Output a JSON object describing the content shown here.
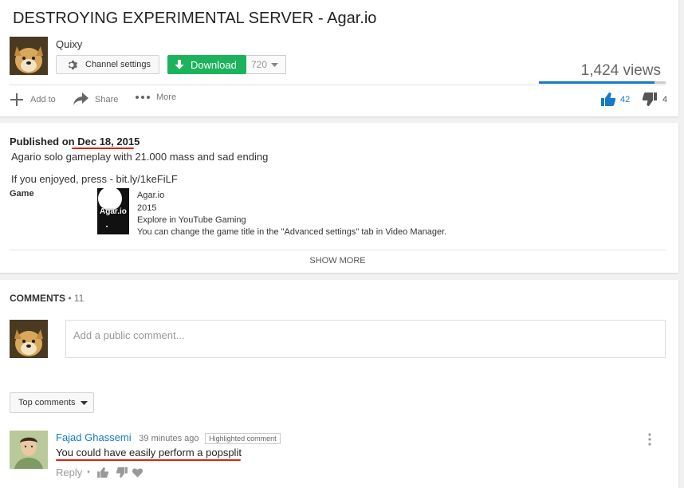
{
  "video": {
    "title": "DESTROYING EXPERIMENTAL SERVER - Agar.io",
    "channel_name": "Quixy",
    "channel_settings_label": "Channel settings",
    "download_label": "Download",
    "quality": "720",
    "views": "1,424 views",
    "actions": {
      "add_to": "Add to",
      "share": "Share",
      "more": "More"
    },
    "likes": "42",
    "dislikes": "4",
    "like_ratio": 0.91
  },
  "description": {
    "published_prefix": "Published on ",
    "published_date": "Dec 18, 2015",
    "line1": "Agario solo gameplay with 21.000 mass and sad ending",
    "line2": "If you enjoyed, press - bit.ly/1keFiLF",
    "game_label": "Game",
    "game_thumb_text": "Agar.io",
    "game_title": "Agar.io",
    "game_year": "2015",
    "game_explore": "Explore in YouTube Gaming",
    "game_note": "You can change the game title in the \"Advanced settings\" tab in Video Manager.",
    "show_more": "SHOW MORE"
  },
  "comments": {
    "header": "COMMENTS",
    "separator": " • ",
    "count": "11",
    "placeholder": "Add a public comment...",
    "sort_label": "Top comments",
    "items": [
      {
        "author": "Fajad Ghassemi",
        "time": "39 minutes ago",
        "badge": "Highlighted comment",
        "text": "You could have easily perform a popsplit",
        "reply": "Reply",
        "reply_sep": "•"
      }
    ]
  },
  "colors": {
    "accent_blue": "#167ac6",
    "download_green": "#1cb35c",
    "annotation_red": "#dd1111"
  },
  "icons": [
    "gear-icon",
    "download-arrow-icon",
    "chevron-down-icon",
    "plus-icon",
    "share-arrow-icon",
    "more-dots-icon",
    "thumbs-up-icon",
    "thumbs-down-icon",
    "kebab-menu-icon",
    "heart-icon"
  ]
}
